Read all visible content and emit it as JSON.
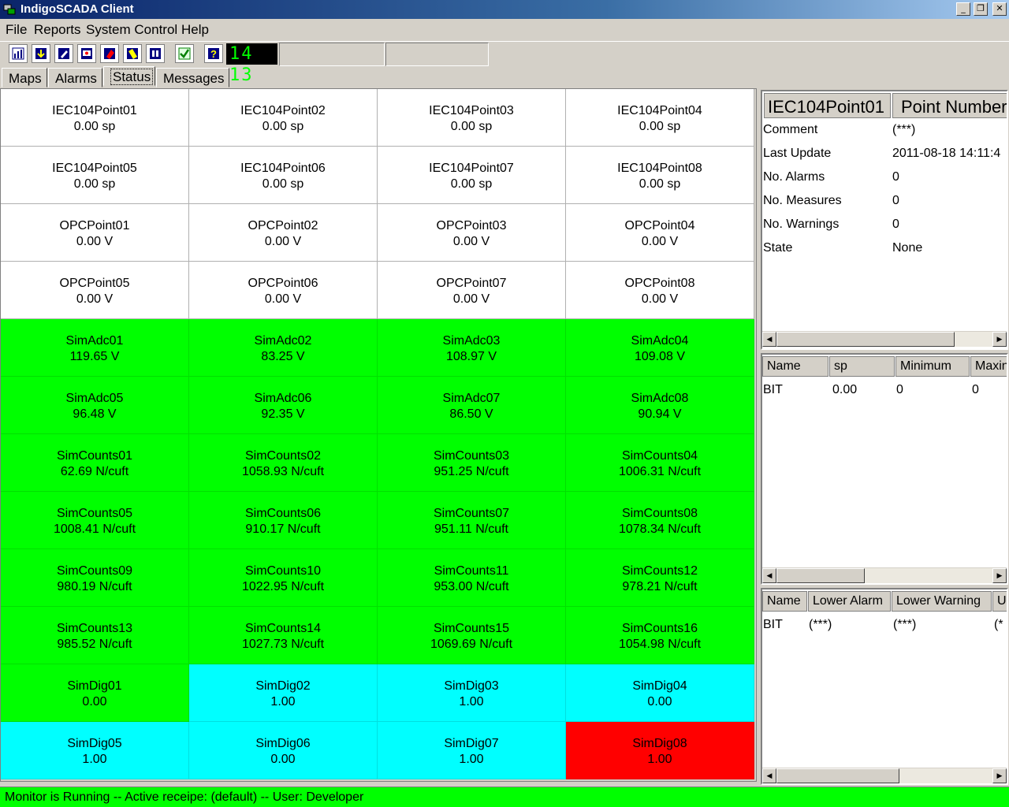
{
  "window": {
    "title": "IndigoSCADA Client"
  },
  "menu": [
    "File",
    "Reports",
    "System Control",
    "Help"
  ],
  "toolbar": {
    "icons": [
      "chart-icon",
      "download-icon",
      "edit-icon",
      "config-icon",
      "flag-icon",
      "note-icon",
      "pause-icon",
      "ack-icon",
      "help-icon"
    ],
    "clock": "14 13"
  },
  "tabs": [
    "Maps",
    "Alarms",
    "Status",
    "Messages"
  ],
  "active_tab": "Status",
  "colors": {
    "white": "#ffffff",
    "green": "#00ff00",
    "cyan": "#00ffff",
    "red": "#ff0000"
  },
  "grid": [
    {
      "name": "IEC104Point01",
      "value": "0.00 sp",
      "color": "white"
    },
    {
      "name": "IEC104Point02",
      "value": "0.00 sp",
      "color": "white"
    },
    {
      "name": "IEC104Point03",
      "value": "0.00 sp",
      "color": "white"
    },
    {
      "name": "IEC104Point04",
      "value": "0.00 sp",
      "color": "white"
    },
    {
      "name": "IEC104Point05",
      "value": "0.00 sp",
      "color": "white"
    },
    {
      "name": "IEC104Point06",
      "value": "0.00 sp",
      "color": "white"
    },
    {
      "name": "IEC104Point07",
      "value": "0.00 sp",
      "color": "white"
    },
    {
      "name": "IEC104Point08",
      "value": "0.00 sp",
      "color": "white"
    },
    {
      "name": "OPCPoint01",
      "value": "0.00 V",
      "color": "white"
    },
    {
      "name": "OPCPoint02",
      "value": "0.00 V",
      "color": "white"
    },
    {
      "name": "OPCPoint03",
      "value": "0.00 V",
      "color": "white"
    },
    {
      "name": "OPCPoint04",
      "value": "0.00 V",
      "color": "white"
    },
    {
      "name": "OPCPoint05",
      "value": "0.00 V",
      "color": "white"
    },
    {
      "name": "OPCPoint06",
      "value": "0.00 V",
      "color": "white"
    },
    {
      "name": "OPCPoint07",
      "value": "0.00 V",
      "color": "white"
    },
    {
      "name": "OPCPoint08",
      "value": "0.00 V",
      "color": "white"
    },
    {
      "name": "SimAdc01",
      "value": "119.65 V",
      "color": "green"
    },
    {
      "name": "SimAdc02",
      "value": "83.25 V",
      "color": "green"
    },
    {
      "name": "SimAdc03",
      "value": "108.97 V",
      "color": "green"
    },
    {
      "name": "SimAdc04",
      "value": "109.08 V",
      "color": "green"
    },
    {
      "name": "SimAdc05",
      "value": "96.48 V",
      "color": "green"
    },
    {
      "name": "SimAdc06",
      "value": "92.35 V",
      "color": "green"
    },
    {
      "name": "SimAdc07",
      "value": "86.50 V",
      "color": "green"
    },
    {
      "name": "SimAdc08",
      "value": "90.94 V",
      "color": "green"
    },
    {
      "name": "SimCounts01",
      "value": "62.69 N/cuft",
      "color": "green"
    },
    {
      "name": "SimCounts02",
      "value": "1058.93 N/cuft",
      "color": "green"
    },
    {
      "name": "SimCounts03",
      "value": "951.25 N/cuft",
      "color": "green"
    },
    {
      "name": "SimCounts04",
      "value": "1006.31 N/cuft",
      "color": "green"
    },
    {
      "name": "SimCounts05",
      "value": "1008.41 N/cuft",
      "color": "green"
    },
    {
      "name": "SimCounts06",
      "value": "910.17 N/cuft",
      "color": "green"
    },
    {
      "name": "SimCounts07",
      "value": "951.11 N/cuft",
      "color": "green"
    },
    {
      "name": "SimCounts08",
      "value": "1078.34 N/cuft",
      "color": "green"
    },
    {
      "name": "SimCounts09",
      "value": "980.19 N/cuft",
      "color": "green"
    },
    {
      "name": "SimCounts10",
      "value": "1022.95 N/cuft",
      "color": "green"
    },
    {
      "name": "SimCounts11",
      "value": "953.00 N/cuft",
      "color": "green"
    },
    {
      "name": "SimCounts12",
      "value": "978.21 N/cuft",
      "color": "green"
    },
    {
      "name": "SimCounts13",
      "value": "985.52 N/cuft",
      "color": "green"
    },
    {
      "name": "SimCounts14",
      "value": "1027.73 N/cuft",
      "color": "green"
    },
    {
      "name": "SimCounts15",
      "value": "1069.69 N/cuft",
      "color": "green"
    },
    {
      "name": "SimCounts16",
      "value": "1054.98 N/cuft",
      "color": "green"
    },
    {
      "name": "SimDig01",
      "value": "0.00",
      "color": "green"
    },
    {
      "name": "SimDig02",
      "value": "1.00",
      "color": "cyan"
    },
    {
      "name": "SimDig03",
      "value": "1.00",
      "color": "cyan"
    },
    {
      "name": "SimDig04",
      "value": "0.00",
      "color": "cyan"
    },
    {
      "name": "SimDig05",
      "value": "1.00",
      "color": "cyan"
    },
    {
      "name": "SimDig06",
      "value": "0.00",
      "color": "cyan"
    },
    {
      "name": "SimDig07",
      "value": "1.00",
      "color": "cyan"
    },
    {
      "name": "SimDig08",
      "value": "1.00",
      "color": "red"
    }
  ],
  "details": {
    "header_name": "IEC104Point01",
    "header_number": "Point Number",
    "properties": [
      {
        "key": "Comment",
        "value": "(***)"
      },
      {
        "key": "Last Update",
        "value": "2011-08-18 14:11:4"
      },
      {
        "key": "No. Alarms",
        "value": "0"
      },
      {
        "key": "No. Measures",
        "value": "0"
      },
      {
        "key": "No. Warnings",
        "value": "0"
      },
      {
        "key": "State",
        "value": "None"
      }
    ],
    "measures": {
      "columns": [
        "Name",
        "sp",
        "Minimum",
        "Maxin"
      ],
      "rows": [
        [
          "BIT",
          "0.00",
          "0",
          "0"
        ]
      ]
    },
    "limits": {
      "columns": [
        "Name",
        "Lower Alarm",
        "Lower Warning",
        "U"
      ],
      "rows": [
        [
          "BIT",
          "(***)",
          "(***)",
          "(*"
        ]
      ]
    }
  },
  "status": "Monitor is Running -- Active receipe: (default) -- User: Developer"
}
